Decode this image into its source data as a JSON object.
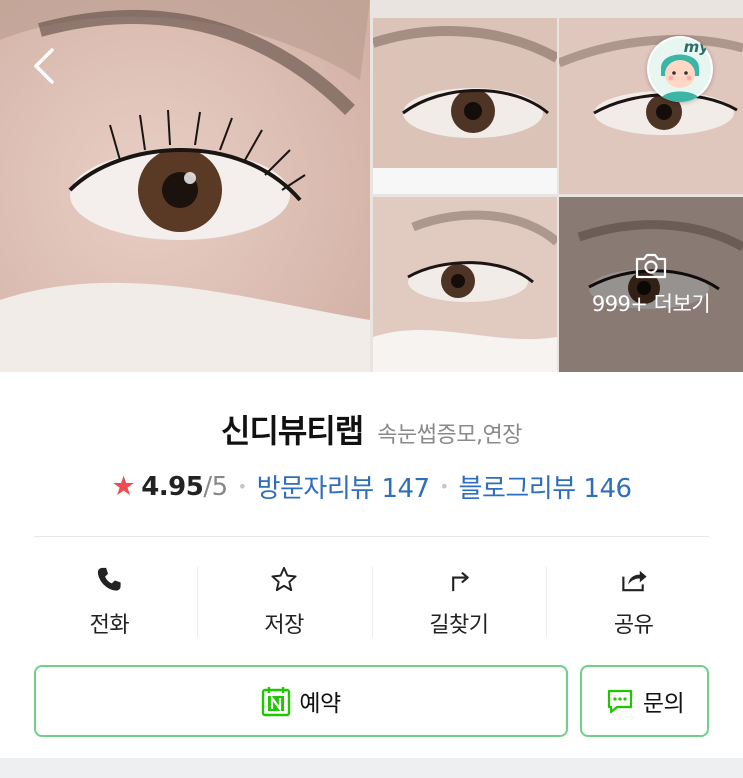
{
  "gallery": {
    "more_text": "999+ 더보기"
  },
  "avatar": {
    "badge_text": "my"
  },
  "place": {
    "name": "신디뷰티랩",
    "category": "속눈썹증모,연장"
  },
  "rating": {
    "score": "4.95",
    "max": "/5",
    "visitor_reviews": "방문자리뷰 147",
    "blog_reviews": "블로그리뷰 146"
  },
  "actions": [
    {
      "label": "전화",
      "icon": "phone-icon"
    },
    {
      "label": "저장",
      "icon": "star-outline-icon"
    },
    {
      "label": "길찾기",
      "icon": "directions-icon"
    },
    {
      "label": "공유",
      "icon": "share-icon"
    }
  ],
  "cta": {
    "reserve_label": "예약",
    "inquiry_label": "문의"
  },
  "colors": {
    "accent_green": "#6fd08a",
    "naver_green": "#1ec800",
    "link_blue": "#2f6ebd",
    "star_red": "#ef4b52"
  }
}
